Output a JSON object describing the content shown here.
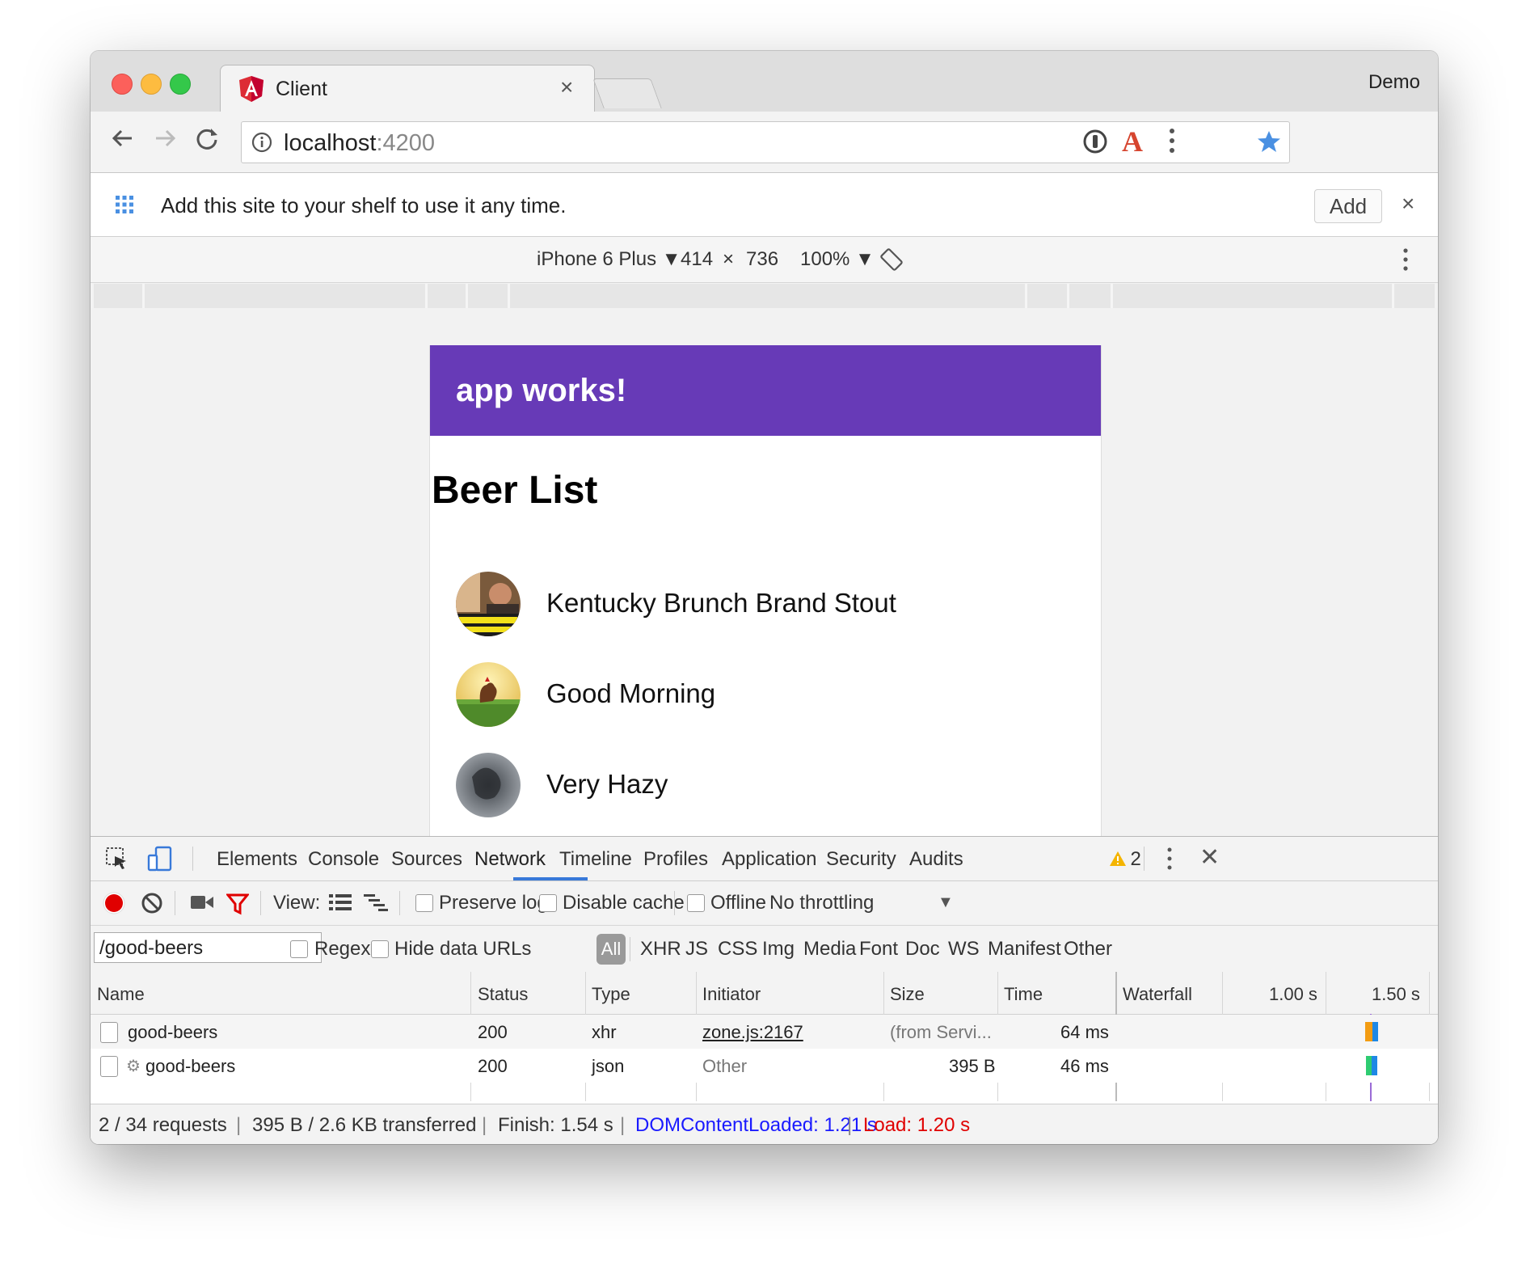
{
  "window": {
    "tab_title": "Client",
    "profile_name": "Demo"
  },
  "toolbar": {
    "url_host": "localhost",
    "url_port": ":4200"
  },
  "shelf": {
    "message": "Add this site to your shelf to use it any time.",
    "add_label": "Add"
  },
  "device_toolbar": {
    "device": "iPhone 6 Plus",
    "width": "414",
    "times": "×",
    "height": "736",
    "zoom": "100%"
  },
  "app": {
    "title": "app works!",
    "heading": "Beer List",
    "beers": [
      {
        "name": "Kentucky Brunch Brand Stout"
      },
      {
        "name": "Good Morning"
      },
      {
        "name": "Very Hazy"
      }
    ]
  },
  "devtools": {
    "tabs": [
      "Elements",
      "Console",
      "Sources",
      "Network",
      "Timeline",
      "Profiles",
      "Application",
      "Security",
      "Audits"
    ],
    "active_tab": "Network",
    "warning_count": "2",
    "controls": {
      "view_label": "View:",
      "preserve_log": "Preserve log",
      "disable_cache": "Disable cache",
      "offline": "Offline",
      "throttling": "No throttling"
    },
    "filter": {
      "value": "/good-beers",
      "regex": "Regex",
      "hide_data_urls": "Hide data URLs",
      "types": [
        "All",
        "XHR",
        "JS",
        "CSS",
        "Img",
        "Media",
        "Font",
        "Doc",
        "WS",
        "Manifest",
        "Other"
      ]
    },
    "columns": {
      "name": "Name",
      "status": "Status",
      "type": "Type",
      "initiator": "Initiator",
      "size": "Size",
      "time": "Time",
      "waterfall": "Waterfall",
      "tick1": "1.00 s",
      "tick2": "1.50 s"
    },
    "rows": [
      {
        "name": "good-beers",
        "status": "200",
        "type": "xhr",
        "initiator": "zone.js:2167",
        "size": "(from Servi...",
        "time": "64 ms"
      },
      {
        "name": "good-beers",
        "status": "200",
        "type": "json",
        "initiator": "Other",
        "size": "395 B",
        "time": "46 ms"
      }
    ],
    "status_bar": {
      "requests": "2 / 34 requests",
      "transferred": "395 B / 2.6 KB transferred",
      "finish": "Finish: 1.54 s",
      "dom_loaded": "DOMContentLoaded: 1.21 s",
      "load": "Load: 1.20 s"
    }
  },
  "colors": {
    "app_bar": "#673ab7",
    "tab_active": "#3879d9",
    "dom_loaded": "#1a1aff",
    "load": "#e00000",
    "record": "#e00000"
  }
}
